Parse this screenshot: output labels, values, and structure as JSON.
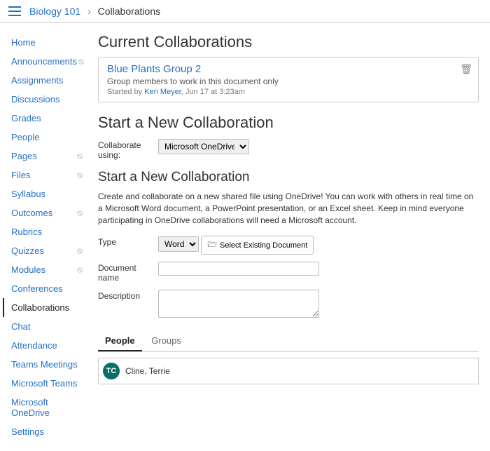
{
  "breadcrumb": {
    "course": "Biology 101",
    "page": "Collaborations"
  },
  "sidebar": {
    "items": [
      {
        "label": "Home",
        "hidden": false
      },
      {
        "label": "Announcements",
        "hidden": true
      },
      {
        "label": "Assignments",
        "hidden": false
      },
      {
        "label": "Discussions",
        "hidden": false
      },
      {
        "label": "Grades",
        "hidden": false
      },
      {
        "label": "People",
        "hidden": false
      },
      {
        "label": "Pages",
        "hidden": true
      },
      {
        "label": "Files",
        "hidden": true
      },
      {
        "label": "Syllabus",
        "hidden": false
      },
      {
        "label": "Outcomes",
        "hidden": true
      },
      {
        "label": "Rubrics",
        "hidden": false
      },
      {
        "label": "Quizzes",
        "hidden": true
      },
      {
        "label": "Modules",
        "hidden": true
      },
      {
        "label": "Conferences",
        "hidden": false
      },
      {
        "label": "Collaborations",
        "hidden": false,
        "active": true
      },
      {
        "label": "Chat",
        "hidden": false
      },
      {
        "label": "Attendance",
        "hidden": false
      },
      {
        "label": "Teams Meetings",
        "hidden": false
      },
      {
        "label": "Microsoft Teams",
        "hidden": false
      },
      {
        "label": "Microsoft OneDrive",
        "hidden": false
      },
      {
        "label": "Settings",
        "hidden": false
      }
    ]
  },
  "main": {
    "current_heading": "Current Collaborations",
    "collab": {
      "title": "Blue Plants Group 2",
      "desc": "Group members to work in this document only",
      "started_prefix": "Started by ",
      "started_by": "Ken Meyer",
      "started_suffix": ", Jun 17 at 3:23am"
    },
    "start_heading": "Start a New Collaboration",
    "using_label": "Collaborate using:",
    "using_value": "Microsoft OneDrive",
    "sub_heading": "Start a New Collaboration",
    "prose": "Create and collaborate on a new shared file using OneDrive! You can work with others in real time on a Microsoft Word document, a PowerPoint presentation, or an Excel sheet. Keep in mind everyone participating in OneDrive collaborations will need a Microsoft account.",
    "form": {
      "type_label": "Type",
      "type_value": "Word",
      "select_existing_label": "Select Existing Document",
      "docname_label": "Document name",
      "desc_label": "Description"
    },
    "tabs": {
      "people": "People",
      "groups": "Groups"
    },
    "people": [
      {
        "initials": "TC",
        "name": "Cline, Terrie"
      }
    ]
  }
}
